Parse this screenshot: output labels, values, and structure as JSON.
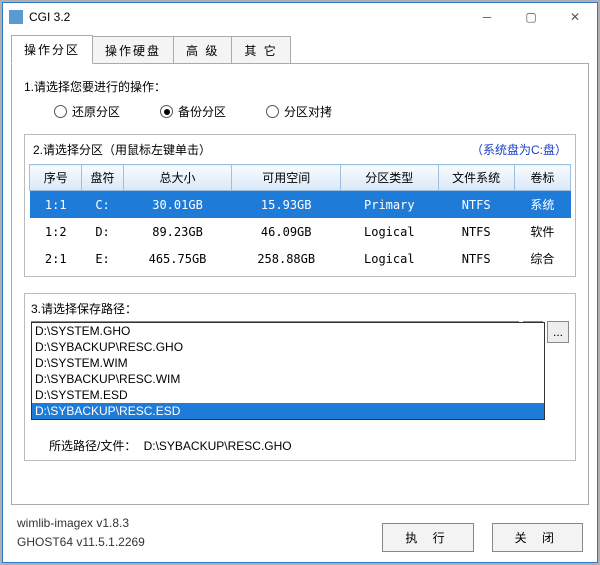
{
  "window": {
    "title": "CGI 3.2"
  },
  "tabs": [
    "操作分区",
    "操作硬盘",
    "高 级",
    "其 它"
  ],
  "active_tab_index": 0,
  "step1": {
    "label": "1.请选择您要进行的操作：",
    "options": [
      "还原分区",
      "备份分区",
      "分区对拷"
    ],
    "selected_index": 1
  },
  "step2": {
    "label": "2.请选择分区（用鼠标左键单击）",
    "hint": "（系统盘为C:盘）",
    "headers": [
      "序号",
      "盘符",
      "总大小",
      "可用空间",
      "分区类型",
      "文件系统",
      "卷标"
    ],
    "rows": [
      {
        "no": "1:1",
        "drive": "C:",
        "total": "30.01GB",
        "free": "15.93GB",
        "ptype": "Primary",
        "fs": "NTFS",
        "label": "系统",
        "selected": true
      },
      {
        "no": "1:2",
        "drive": "D:",
        "total": "89.23GB",
        "free": "46.09GB",
        "ptype": "Logical",
        "fs": "NTFS",
        "label": "软件",
        "selected": false
      },
      {
        "no": "2:1",
        "drive": "E:",
        "total": "465.75GB",
        "free": "258.88GB",
        "ptype": "Logical",
        "fs": "NTFS",
        "label": "综合",
        "selected": false
      }
    ]
  },
  "step3": {
    "label": "3.请选择保存路径：",
    "value": "D:\\SYBACKUP\\RESC.GHO",
    "options": [
      "D:\\SYSTEM.GHO",
      "D:\\SYBACKUP\\RESC.GHO",
      "D:\\SYSTEM.WIM",
      "D:\\SYBACKUP\\RESC.WIM",
      "D:\\SYSTEM.ESD",
      "D:\\SYBACKUP\\RESC.ESD"
    ],
    "highlight_index": 5,
    "chosen_label": "所选路径/文件：",
    "chosen_value": "D:\\SYBACKUP\\RESC.GHO"
  },
  "versions": {
    "line1": "wimlib-imagex v1.8.3",
    "line2": "GHOST64 v11.5.1.2269"
  },
  "buttons": {
    "execute": "执 行",
    "close": "关 闭"
  }
}
